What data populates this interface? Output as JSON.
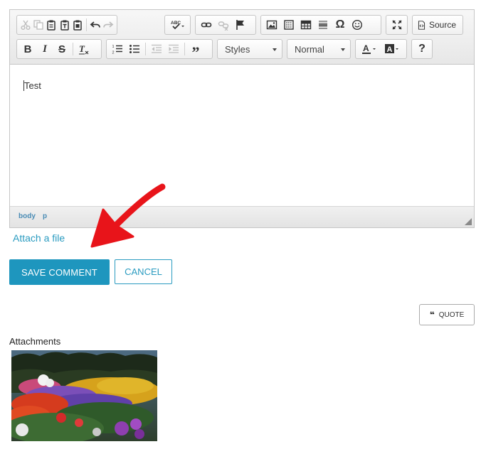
{
  "toolbar": {
    "row1": [
      "cut-icon",
      "copy-icon",
      "paste-icon",
      "paste-text-icon",
      "paste-word-icon",
      "undo-icon",
      "redo-icon",
      "spellcheck-icon",
      "link-icon",
      "unlink-icon",
      "anchor-icon",
      "image-icon",
      "media-icon",
      "table-icon",
      "horizontal-rule-icon",
      "special-char-icon",
      "smiley-icon",
      "maximize-icon",
      "source-icon"
    ],
    "source_label": "Source",
    "row2": [
      "bold-icon",
      "italic-icon",
      "strike-icon",
      "remove-format-icon",
      "numbered-list-icon",
      "bulleted-list-icon",
      "outdent-icon",
      "indent-icon",
      "blockquote-icon",
      "text-color-icon",
      "bg-color-icon",
      "help-icon"
    ],
    "styles_label": "Styles",
    "format_label": "Normal",
    "help_label": "?"
  },
  "editor": {
    "content_text": "Test",
    "path": [
      "body",
      "p"
    ]
  },
  "attach_link": "Attach a file",
  "buttons": {
    "save": "SAVE COMMENT",
    "cancel": "CANCEL",
    "quote": "QUOTE"
  },
  "attachments": {
    "title": "Attachments"
  },
  "colors": {
    "accent": "#1e96be",
    "link": "#2a9bc0",
    "annotation_arrow": "#e8141a"
  }
}
